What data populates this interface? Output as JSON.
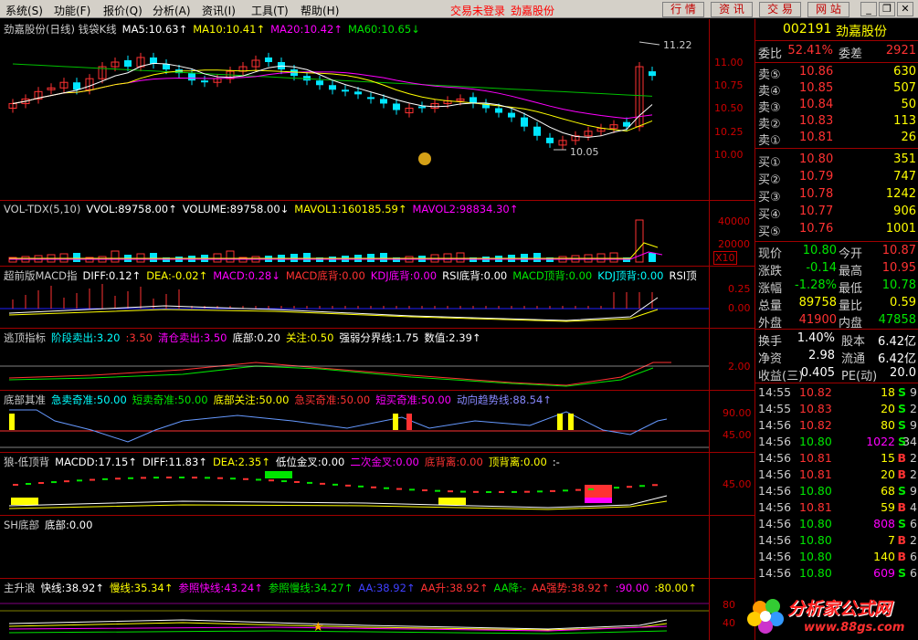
{
  "menu": {
    "items": [
      "系统(S)",
      "功能(F)",
      "报价(Q)",
      "分析(A)",
      "资讯(I)",
      "工具(T)",
      "帮助(H)"
    ],
    "status": "交易未登录",
    "stock_name": "劲嘉股份",
    "buttons": [
      "行 情",
      "资 讯",
      "交 易",
      "网 站"
    ]
  },
  "panels": {
    "kline": {
      "title": "劲嘉股份(日线) 钱袋K线",
      "ma5": "MA5:10.63↑",
      "ma10": "MA10:10.41↑",
      "ma20": "MA20:10.42↑",
      "ma60": "MA60:10.65↓",
      "high_label": "11.22",
      "low_label": "10.05",
      "y_ticks": [
        "11.00",
        "10.75",
        "10.50",
        "10.25",
        "10.00"
      ]
    },
    "vol": {
      "title": "VOL-TDX(5,10)",
      "vvol": "VVOL:89758.00↑",
      "volume": "VOLUME:89758.00↓",
      "mavol1": "MAVOL1:160185.59↑",
      "mavol2": "MAVOL2:98834.30↑",
      "y_ticks": [
        "40000",
        "20000"
      ],
      "unit": "X10"
    },
    "macd": {
      "title": "超前版MACD指",
      "diff": "DIFF:0.12↑",
      "dea": "DEA:-0.02↑",
      "macd": "MACD:0.28↓",
      "macd_bottom": "MACD底背:0.00",
      "kdj_bottom": "KDJ底背:0.00",
      "rsi_bottom": "RSI底背:0.00",
      "macd_top": "MACD顶背:0.00",
      "kdj_top": "KDJ顶背:0.00",
      "rsi_top": "RSI顶",
      "y_ticks": [
        "0.25",
        "0.00"
      ]
    },
    "escape": {
      "title": "逃顶指标",
      "stage_sell": "阶段卖出:3.20",
      "stage_sell2": ":3.50",
      "clear_sell": "清仓卖出:3.50",
      "bottom": "底部:0.20",
      "attention": "关注:0.50",
      "strong_weak": "强弱分界线:1.75",
      "value": "数值:2.39↑",
      "y_ticks": [
        "2.00"
      ]
    },
    "bottom_ind": {
      "title": "底部其准",
      "a": "急卖奇准:50.00",
      "b": "短卖奇准:50.00",
      "c": "底部关注:50.00",
      "d": "急买奇准:50.00",
      "e": "短买奇准:50.00",
      "f": "动向趋势线:88.54↑",
      "y_ticks": [
        "90.00",
        "45.00"
      ]
    },
    "wolf": {
      "title": "狼-低顶背",
      "macdd": "MACDD:17.15↑",
      "diff": "DIFF:11.83↑",
      "dea": "DEA:2.35↑",
      "low_cross": "低位金叉:0.00",
      "second_cross": "二次金叉:0.00",
      "bottom_div": "底背离:0.00",
      "top_div": "顶背离:0.00",
      "tail": ":-",
      "y_ticks": [
        "45.00"
      ]
    },
    "sh": {
      "title": "SH底部",
      "bottom": "底部:0.00"
    },
    "rise": {
      "title": "主升浪",
      "fast": "快线:38.92↑",
      "slow": "慢线:35.34↑",
      "ref_fast": "参照快线:43.24↑",
      "ref_slow": "参照慢线:34.27↑",
      "aa": "AA:38.92↑",
      "aa_up": "AA升:38.92↑",
      "aa_down": "AA降:-",
      "aa_strong": "AA强势:38.92↑",
      "v90": ":90.00",
      "v80": ":80.00↑",
      "y_ticks": [
        "80",
        "40"
      ]
    }
  },
  "quote": {
    "code": "002191",
    "name": "劲嘉股份",
    "weibi_label": "委比",
    "weibi": "52.41%",
    "weicha_label": "委差",
    "weicha": "2921",
    "asks": [
      {
        "label": "卖⑤",
        "price": "10.86",
        "vol": "630"
      },
      {
        "label": "卖④",
        "price": "10.85",
        "vol": "507"
      },
      {
        "label": "卖③",
        "price": "10.84",
        "vol": "50"
      },
      {
        "label": "卖②",
        "price": "10.83",
        "vol": "113"
      },
      {
        "label": "卖①",
        "price": "10.81",
        "vol": "26"
      }
    ],
    "bids": [
      {
        "label": "买①",
        "price": "10.80",
        "vol": "351"
      },
      {
        "label": "买②",
        "price": "10.79",
        "vol": "747"
      },
      {
        "label": "买③",
        "price": "10.78",
        "vol": "1242"
      },
      {
        "label": "买④",
        "price": "10.77",
        "vol": "906"
      },
      {
        "label": "买⑤",
        "price": "10.76",
        "vol": "1001"
      }
    ],
    "stats": [
      {
        "l": "现价",
        "v": "10.80",
        "vc": "green",
        "l2": "今开",
        "v2": "10.87",
        "v2c": "red"
      },
      {
        "l": "涨跌",
        "v": "-0.14",
        "vc": "green",
        "l2": "最高",
        "v2": "10.95",
        "v2c": "red"
      },
      {
        "l": "涨幅",
        "v": "-1.28%",
        "vc": "green",
        "l2": "最低",
        "v2": "10.78",
        "v2c": "green"
      },
      {
        "l": "总量",
        "v": "89758",
        "vc": "yellow",
        "l2": "量比",
        "v2": "0.59",
        "v2c": "yellow"
      },
      {
        "l": "外盘",
        "v": "41900",
        "vc": "red",
        "l2": "内盘",
        "v2": "47858",
        "v2c": "green"
      }
    ],
    "stats2": [
      {
        "l": "换手",
        "v": "1.40%",
        "vc": "white",
        "l2": "股本",
        "v2": "6.42亿",
        "v2c": "white"
      },
      {
        "l": "净资",
        "v": "2.98",
        "vc": "white",
        "l2": "流通",
        "v2": "6.42亿",
        "v2c": "white"
      },
      {
        "l": "收益(三)",
        "v": "0.405",
        "vc": "white",
        "l2": "PE(动)",
        "v2": "20.0",
        "v2c": "white"
      }
    ],
    "ticks": [
      {
        "t": "14:55",
        "p": "10.82",
        "pc": "red",
        "v": "18",
        "bs": "S",
        "n": "9"
      },
      {
        "t": "14:55",
        "p": "10.83",
        "pc": "red",
        "v": "20",
        "bs": "S",
        "n": "2"
      },
      {
        "t": "14:56",
        "p": "10.82",
        "pc": "red",
        "v": "80",
        "bs": "S",
        "n": "9"
      },
      {
        "t": "14:56",
        "p": "10.80",
        "pc": "green",
        "v": "1022",
        "bs": "S",
        "n": "34"
      },
      {
        "t": "14:56",
        "p": "10.81",
        "pc": "red",
        "v": "15",
        "bs": "B",
        "n": "2"
      },
      {
        "t": "14:56",
        "p": "10.81",
        "pc": "red",
        "v": "20",
        "bs": "B",
        "n": "2"
      },
      {
        "t": "14:56",
        "p": "10.80",
        "pc": "green",
        "v": "68",
        "bs": "S",
        "n": "9"
      },
      {
        "t": "14:56",
        "p": "10.81",
        "pc": "red",
        "v": "59",
        "bs": "B",
        "n": "4"
      },
      {
        "t": "14:56",
        "p": "10.80",
        "pc": "green",
        "v": "808",
        "bs": "S",
        "n": "6"
      },
      {
        "t": "14:56",
        "p": "10.80",
        "pc": "green",
        "v": "7",
        "bs": "B",
        "n": "2"
      },
      {
        "t": "14:56",
        "p": "10.80",
        "pc": "green",
        "v": "140",
        "bs": "B",
        "n": "6"
      },
      {
        "t": "14:56",
        "p": "10.80",
        "pc": "green",
        "v": "609",
        "bs": "S",
        "n": "6"
      }
    ]
  },
  "watermark": {
    "text": "分析家公式网",
    "url": "www.88gs.com"
  }
}
